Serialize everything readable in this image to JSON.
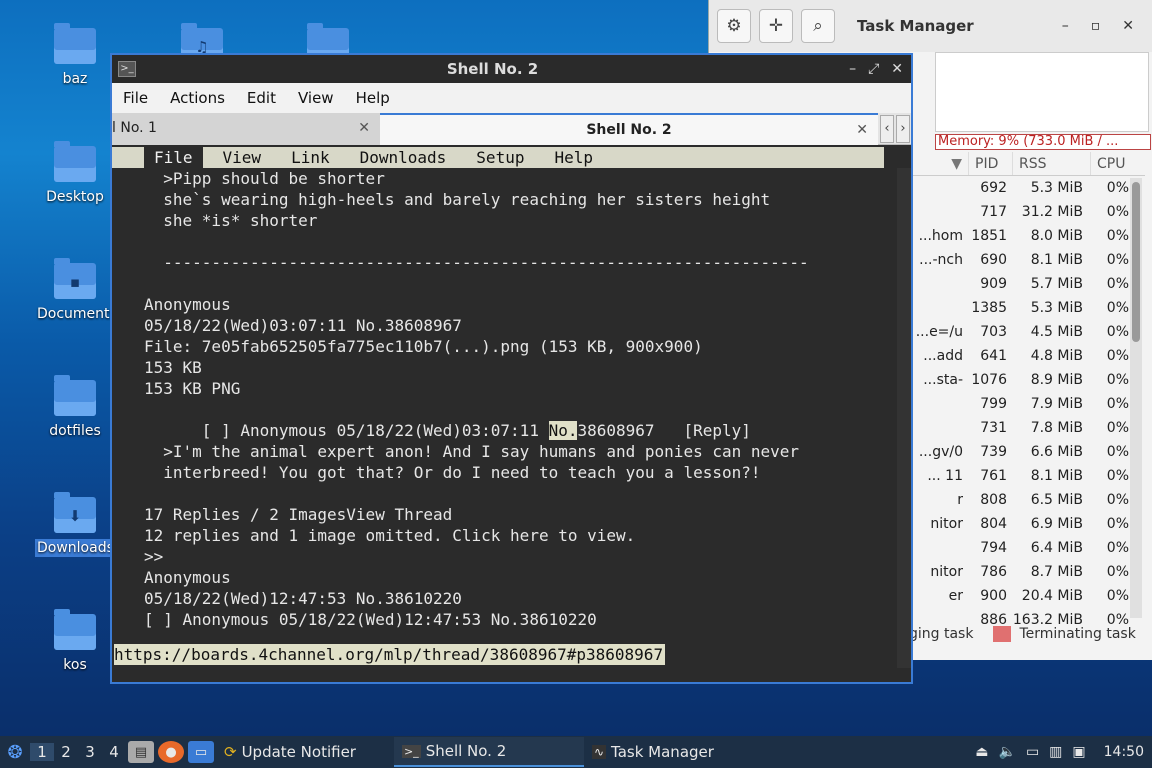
{
  "desktop": {
    "icons": [
      {
        "label": "baz",
        "glyph": ""
      },
      {
        "label": "Desktop",
        "glyph": ""
      },
      {
        "label": "Documents",
        "glyph": "▪"
      },
      {
        "label": "dotfiles",
        "glyph": ""
      },
      {
        "label": "Downloads",
        "glyph": "⬇"
      },
      {
        "label": "kos",
        "glyph": ""
      }
    ],
    "background_color": "#0d5aa8"
  },
  "task_manager": {
    "title": "Task Manager",
    "memory": "Memory: 9% (733.0 MiB / ...",
    "columns": [
      "PID",
      "RSS",
      "CPU"
    ],
    "rows": [
      {
        "name": "",
        "pid": "692",
        "rss": "5.3 MiB",
        "cpu": "0%"
      },
      {
        "name": "",
        "pid": "717",
        "rss": "31.2 MiB",
        "cpu": "0%"
      },
      {
        "name": "hom...",
        "pid": "1851",
        "rss": "8.0 MiB",
        "cpu": "0%"
      },
      {
        "name": "nch-...",
        "pid": "690",
        "rss": "8.1 MiB",
        "cpu": "0%"
      },
      {
        "name": "",
        "pid": "909",
        "rss": "5.7 MiB",
        "cpu": "0%"
      },
      {
        "name": "",
        "pid": "1385",
        "rss": "5.3 MiB",
        "cpu": "0%"
      },
      {
        "name": "e=/u...",
        "pid": "703",
        "rss": "4.5 MiB",
        "cpu": "0%"
      },
      {
        "name": "add...",
        "pid": "641",
        "rss": "4.8 MiB",
        "cpu": "0%"
      },
      {
        "name": "-sta...",
        "pid": "1076",
        "rss": "8.9 MiB",
        "cpu": "0%"
      },
      {
        "name": "",
        "pid": "799",
        "rss": "7.9 MiB",
        "cpu": "0%"
      },
      {
        "name": "",
        "pid": "731",
        "rss": "7.8 MiB",
        "cpu": "0%"
      },
      {
        "name": "0/gv...",
        "pid": "739",
        "rss": "6.6 MiB",
        "cpu": "0%"
      },
      {
        "name": "11 ...",
        "pid": "761",
        "rss": "8.1 MiB",
        "cpu": "0%"
      },
      {
        "name": "r",
        "pid": "808",
        "rss": "6.5 MiB",
        "cpu": "0%"
      },
      {
        "name": "nitor",
        "pid": "804",
        "rss": "6.9 MiB",
        "cpu": "0%"
      },
      {
        "name": "",
        "pid": "794",
        "rss": "6.4 MiB",
        "cpu": "0%"
      },
      {
        "name": "nitor",
        "pid": "786",
        "rss": "8.7 MiB",
        "cpu": "0%"
      },
      {
        "name": "er",
        "pid": "900",
        "rss": "20.4 MiB",
        "cpu": "0%"
      },
      {
        "name": "",
        "pid": "886",
        "rss": "163.2 MiB",
        "cpu": "0%"
      }
    ],
    "legend_starting": "ging task",
    "legend_terminating": "Terminating task"
  },
  "shell": {
    "title": "Shell No. 2",
    "menu": [
      "File",
      "Actions",
      "Edit",
      "View",
      "Help"
    ],
    "tab1": "l No. 1",
    "tab2": "Shell No. 2",
    "lynx_menu": [
      "File",
      "View",
      "Link",
      "Downloads",
      "Setup",
      "Help"
    ],
    "lines": [
      "  >Pipp should be shorter",
      "  she`s wearing high-heels and barely reaching her sisters height",
      "  she *is* shorter",
      "",
      "  -------------------------------------------------------------------",
      "",
      "Anonymous",
      "05/18/22(Wed)03:07:11 No.38608967",
      "File: 7e05fab652505fa775ec110b7(...).png (153 KB, 900x900)",
      "153 KB",
      "153 KB PNG",
      "",
      "",
      "  >I'm the animal expert anon! And I say humans and ponies can never",
      "  interbreed! You got that? Or do I need to teach you a lesson?!",
      "",
      "17 Replies / 2 ImagesView Thread",
      "12 replies and 1 image omitted. Click here to view.",
      ">>",
      "Anonymous",
      "05/18/22(Wed)12:47:53 No.38610220",
      "[ ] Anonymous 05/18/22(Wed)12:47:53 No.38610220"
    ],
    "reply_line_pre": "[ ] Anonymous 05/18/22(Wed)03:07:11 ",
    "reply_line_hl": "No.",
    "reply_line_post": "38608967   [Reply]",
    "status_url": "https://boards.4channel.org/mlp/thread/38608967#p38608967"
  },
  "taskbar": {
    "workspaces": [
      "1",
      "2",
      "3",
      "4"
    ],
    "tasks": [
      "Update Notifier",
      "Shell No. 2",
      "Task Manager"
    ],
    "clock": "14:50"
  }
}
